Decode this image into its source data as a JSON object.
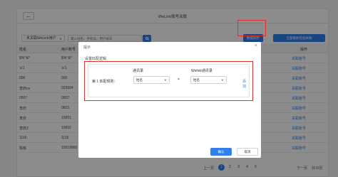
{
  "header": {
    "back_icon": "arrow-left-icon",
    "title": "WeLink账号关联"
  },
  "toolbar": {
    "filter_value": "未关联WeLink用户",
    "search_placeholder": "输入姓名、手机号、用户账号",
    "search_icon": "search-icon",
    "sync_label": "数据同步",
    "rematch_label": "全部重新检验关联"
  },
  "table": {
    "headers": {
      "name": "姓名",
      "account": "用户账号",
      "op": "操作"
    },
    "rows": [
      {
        "name": "$%^&*",
        "account": "$%^&*",
        "op": "关联账号"
      },
      {
        "name": "'a'1",
        "account": "'a'1",
        "op": "关联账号"
      },
      {
        "name": "000",
        "account": "000",
        "op": "关联账号"
      },
      {
        "name": "李庆cs",
        "account": "023924",
        "op": "关联账号"
      },
      {
        "name": "0507",
        "account": "0507",
        "op": "关联账号"
      },
      {
        "name": "李庆",
        "account": "0815",
        "op": "关联账号"
      },
      {
        "name": "李庆",
        "account": "10001",
        "op": "关联账号"
      },
      {
        "name": "李庆2",
        "account": "10002",
        "op": "关联账号"
      },
      {
        "name": "1116",
        "account": "1116",
        "op": "关联账号"
      },
      {
        "name": "陈栋",
        "account": "15019900",
        "op": "关联账号"
      }
    ]
  },
  "pager": {
    "prev": "上一页",
    "pages": [
      "1",
      "2",
      "3",
      "4",
      "5"
    ],
    "active": "1",
    "next": "下一页",
    "info": "共10页"
  },
  "modal": {
    "title": "提示",
    "close_icon": "close-icon",
    "section_label": "设置匹配逻辑",
    "col_a_header": "通讯录",
    "col_b_header": "Welink通讯录",
    "rule_label": "第 1 匹配规则：",
    "select_a_value": "姓名",
    "equals": "=",
    "select_b_value": "姓名",
    "add_label": "添加",
    "ok_label": "确认",
    "cancel_label": "取消"
  },
  "colors": {
    "accent": "#2f80ed",
    "highlight": "#e03131"
  }
}
